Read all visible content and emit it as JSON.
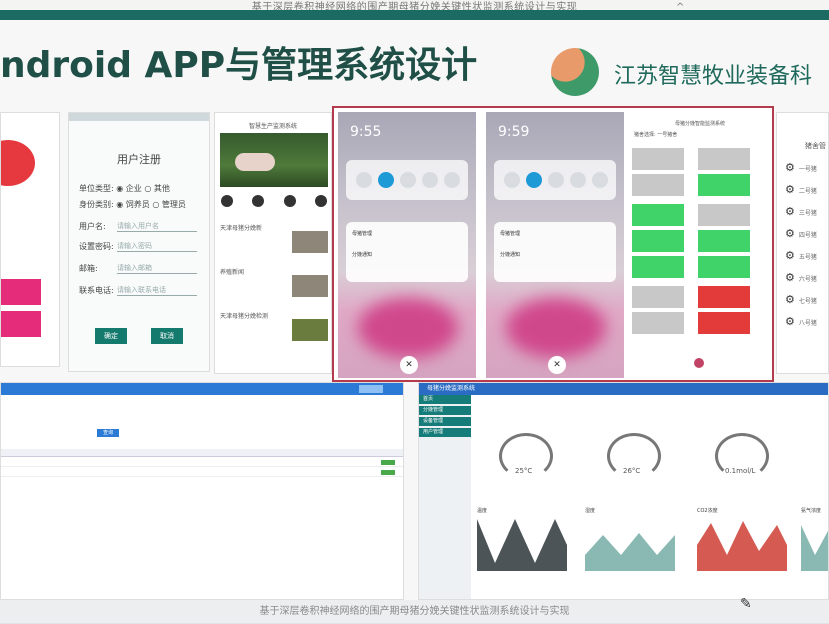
{
  "header": {
    "doc_title": "基于深层卷积神经网络的围产期母猪分娩关键性状监测系统设计与实现",
    "caret": "^"
  },
  "slide": {
    "title": "ndroid APP与管理系统设计",
    "company": "江苏智慧牧业装备科",
    "accent_color": "#1f4f47",
    "brand_color": "#1b6b63"
  },
  "registration": {
    "title": "用户注册",
    "rows": [
      {
        "label": "单位类型:",
        "value": "◉ 企业   ○ 其他"
      },
      {
        "label": "身份类别:",
        "value": "◉ 饲养员   ○ 管理员"
      },
      {
        "label": "用户名:",
        "value": "请输入用户名"
      },
      {
        "label": "设置密码:",
        "value": "请输入密码"
      },
      {
        "label": "邮箱:",
        "value": "请输入邮箱"
      },
      {
        "label": "联系电话:",
        "value": "请输入联系电话"
      }
    ],
    "btn_confirm": "确定",
    "btn_cancel": "取消"
  },
  "news": {
    "header": "智慧生产监测系统",
    "items": [
      {
        "title": "天津母猪分娩新"
      },
      {
        "title": "养殖新闻"
      },
      {
        "title": "天津母猪分娩检测"
      }
    ]
  },
  "phones": [
    {
      "time": "9:55",
      "notif1": "母猪管理",
      "notif2": "分娩通知"
    },
    {
      "time": "9:59",
      "notif1": "母猪管理",
      "notif2": "分娩通知"
    }
  ],
  "grid_panel": {
    "header": "母猪分娩智能监测系统",
    "select_label": "猪舍选择:",
    "select_value": "一号猪舍"
  },
  "settings_list": {
    "title": "猪舍管",
    "items": [
      "一号猪",
      "二号猪",
      "三号猪",
      "四号猪",
      "五号猪",
      "六号猪",
      "七号猪",
      "八号猪"
    ]
  },
  "dashboard": {
    "header": "母猪分娩监测系统",
    "sidebar": [
      "首页",
      "分娩管理",
      "设备管理",
      "用户管理"
    ],
    "gauges": [
      "25°C",
      "26°C",
      "0.1mol/L"
    ],
    "charts": [
      "温度",
      "湿度",
      "CO2浓度",
      "氨气浓度"
    ]
  },
  "table_panel": {
    "search_btn": "查询"
  },
  "footer": {
    "text": "基于深层卷积神经网络的围产期母猪分娩关键性状监测系统设计与实现"
  }
}
